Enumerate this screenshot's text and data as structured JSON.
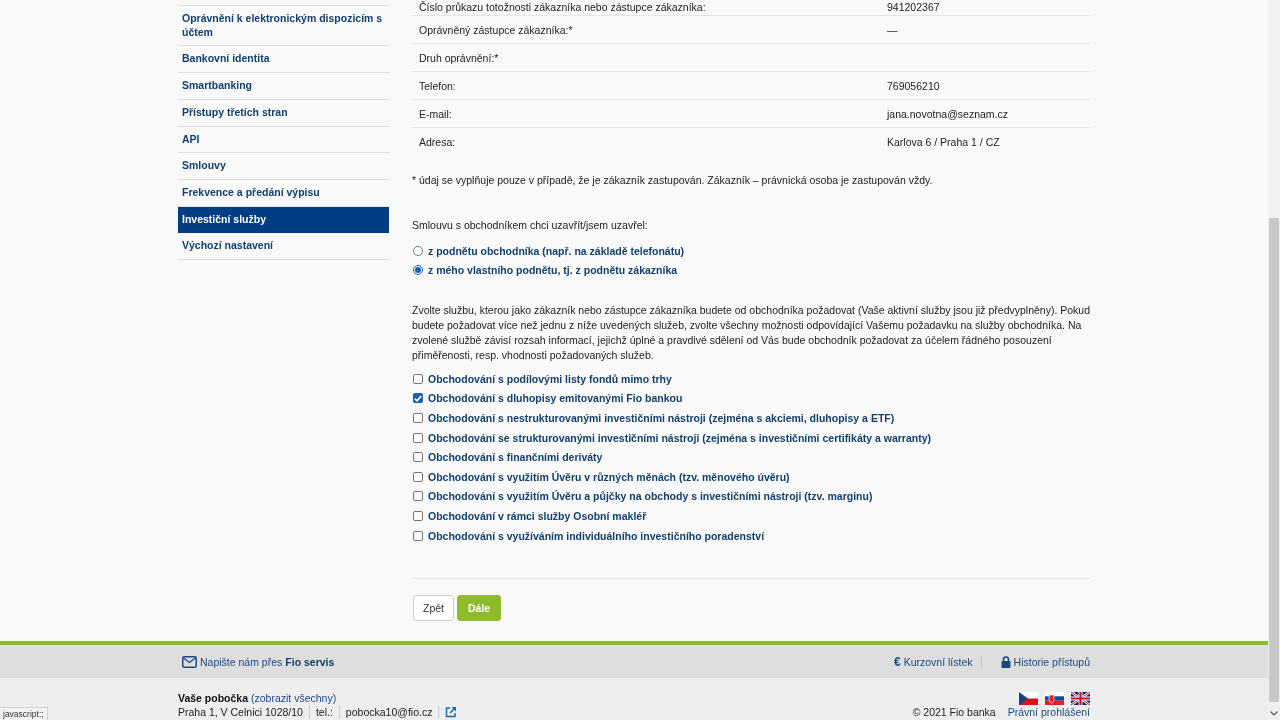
{
  "sidebar": {
    "items": [
      {
        "label": "Oprávnění k elektronickým dispozicím s účtem",
        "selected": false
      },
      {
        "label": "Bankovní identita",
        "selected": false
      },
      {
        "label": "Smartbanking",
        "selected": false
      },
      {
        "label": "Přístupy třetích stran",
        "selected": false
      },
      {
        "label": "API",
        "selected": false
      },
      {
        "label": "Smlouvy",
        "selected": false
      },
      {
        "label": "Frekvence a předání výpisu",
        "selected": false
      },
      {
        "label": "Investiční služby",
        "selected": true
      },
      {
        "label": "Výchozí nastavení",
        "selected": false
      }
    ]
  },
  "details": {
    "rows": [
      {
        "label": "Číslo průkazu totožnosti zákazníka nebo zástupce zákazníka:",
        "value": "941202367"
      },
      {
        "label": "Oprávněný zástupce zákazníka:*",
        "value": "—"
      },
      {
        "label": "Druh oprávnění:*"
      },
      {
        "label": "Telefon:",
        "value": "769056210"
      },
      {
        "label": "E-mail:",
        "value": "jana.novotna@seznam.cz"
      },
      {
        "label": "Adresa:",
        "value": "Karlova 6 / Praha 1 / CZ"
      }
    ],
    "footnote": "* údaj se vyplňuje pouze v případě, že je zákazník zastupován. Zákazník – právnická osoba je zastupován vždy."
  },
  "contract": {
    "question": "Smlouvu s obchodníkem chci uzavřít/jsem uzavřel:",
    "options": [
      {
        "label": "z podnětu obchodníka (např. na základě telefonátu)",
        "selected": false
      },
      {
        "label": "z mého vlastního podnětu, tj. z podnětu zákazníka",
        "selected": true
      }
    ]
  },
  "services": {
    "intro": "Zvolte službu, kterou jako zákazník nebo zástupce zákazníka budete od obchodníka požadovat (Vaše aktivní služby jsou již předvyplněny). Pokud budete požadovat více než jednu z níže uvedených služeb, zvolte všechny možnosti odpovídající Vašemu požadavku na služby obchodníka. Na zvolené službě závisí rozsah informací, jejichž úplné a pravdivé sdělení od Vás bude obchodník požadovat za účelem řádného posouzení přiměřenosti, resp. vhodnosti požadovaných služeb.",
    "options": [
      {
        "label": "Obchodování s podílovými listy fondů mimo trhy",
        "checked": false
      },
      {
        "label": "Obchodování s dluhopisy emitovanými Fio bankou",
        "checked": true
      },
      {
        "label": "Obchodování s nestrukturovanými investičními nástroji (zejména s akciemi, dluhopisy a ETF)",
        "checked": false
      },
      {
        "label": "Obchodování se strukturovanými investičními nástroji (zejména s investičními certifikáty a warranty)",
        "checked": false
      },
      {
        "label": "Obchodování s finančními deriváty",
        "checked": false
      },
      {
        "label": "Obchodování s využitím Úvěru v různých měnách (tzv. měnového úvěru)",
        "checked": false
      },
      {
        "label": "Obchodování s využitím Úvěru a půjčky na obchody s investičními nástroji (tzv. marginu)",
        "checked": false
      },
      {
        "label": "Obchodování v rámci služby Osobní makléř",
        "checked": false
      },
      {
        "label": "Obchodování s využíváním individuálního investičního poradenství",
        "checked": false
      }
    ]
  },
  "buttons": [
    {
      "label": "Zpět",
      "kind": "secondary"
    },
    {
      "label": "Dále",
      "kind": "primary"
    }
  ],
  "footer": {
    "contact": "Napište nám přes **Fio servis**",
    "links": [
      {
        "kind": "symbol",
        "symbol": "€",
        "label": "Kurzovní lístek"
      },
      {
        "kind": "lock",
        "label": "Historie přístupů"
      }
    ],
    "branch": {
      "title": "Vaše pobočka",
      "link": "(zobrazit všechny)",
      "details": [
        "Praha 1, V Celnici 1028/10",
        "tel.:",
        "pobocka10@fio.cz"
      ]
    },
    "copyright": "© 2021 Fio banka",
    "legal_link": "Právní prohlášení"
  },
  "status_bar": "javascript:;"
}
